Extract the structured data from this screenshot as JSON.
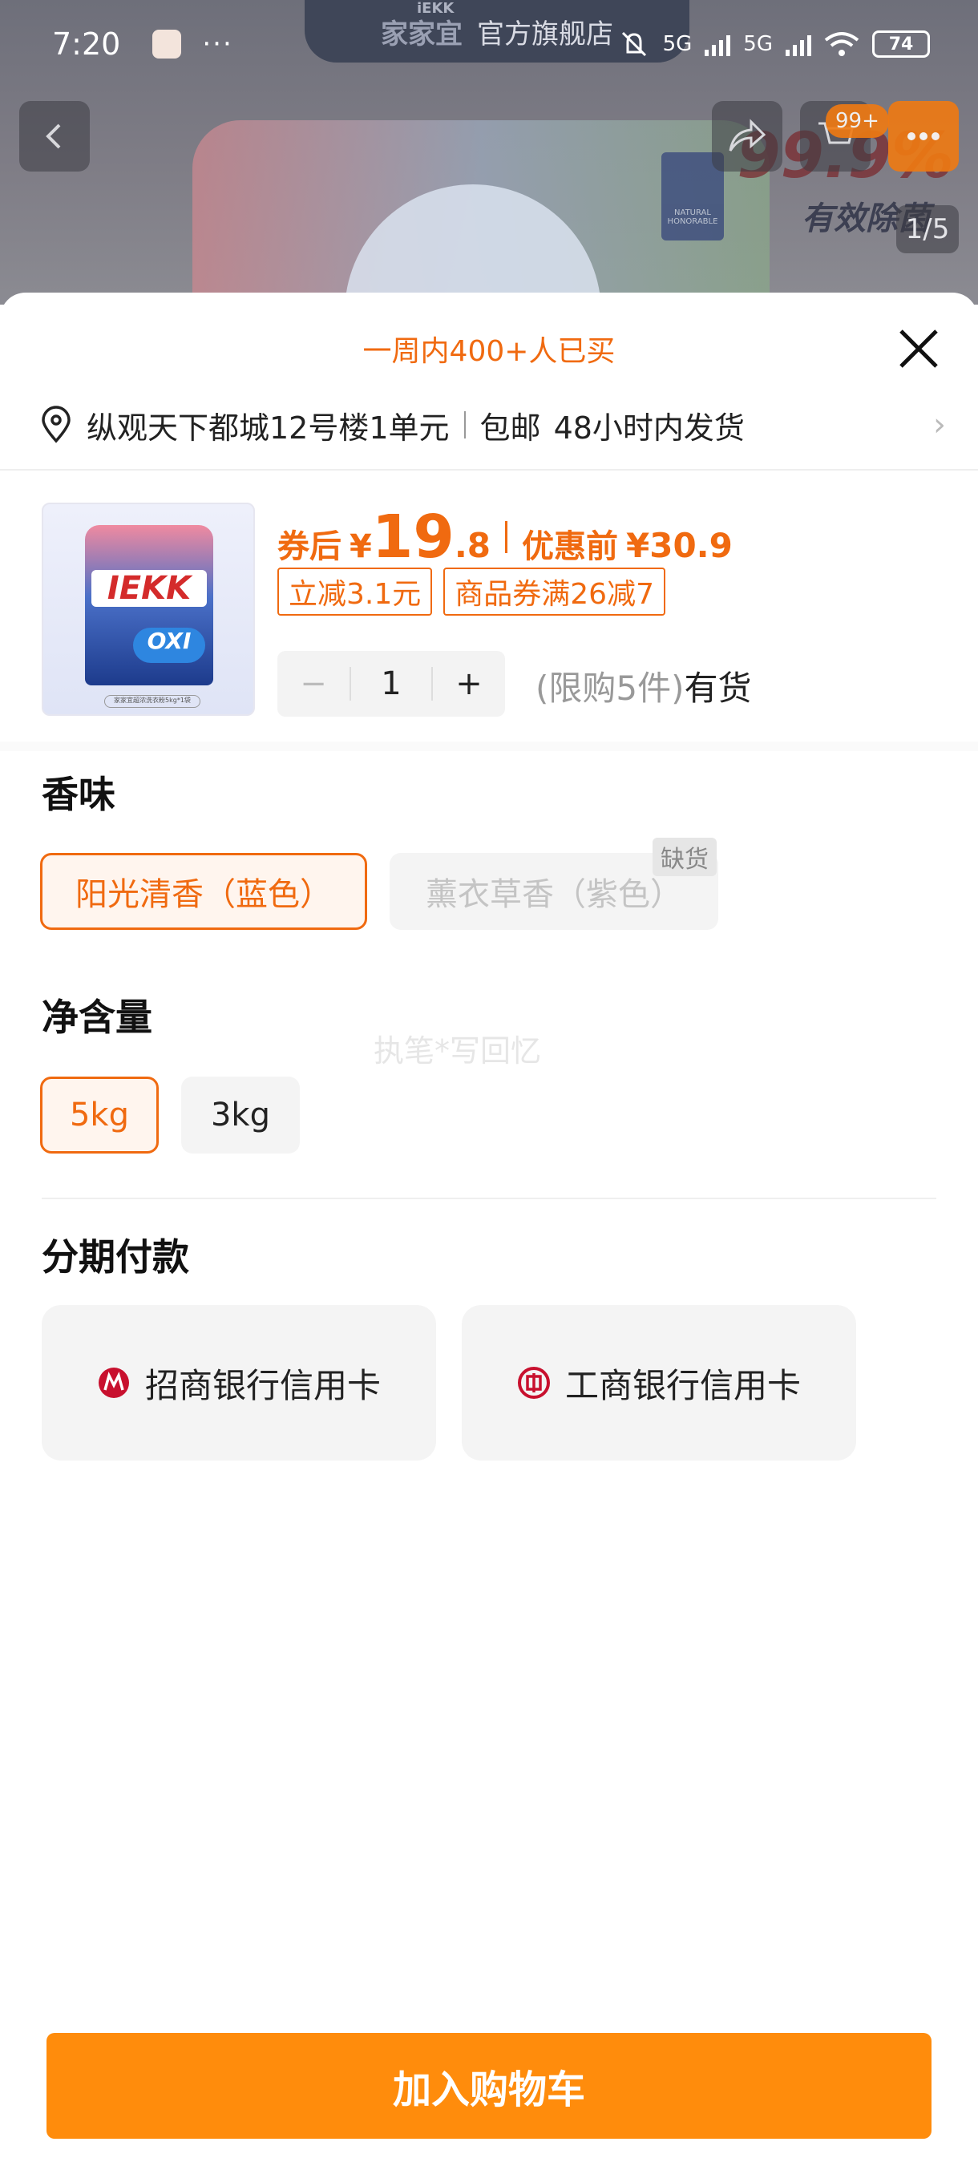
{
  "status_bar": {
    "time": "7:20",
    "dots": "···",
    "net1": "5G",
    "net2": "5G",
    "battery": "74"
  },
  "background": {
    "brand_small": "iEKK",
    "brand": "家家宜",
    "shop_name": "官方旗舰店",
    "promo": "99.9%",
    "promo_sub": "有效除菌",
    "cert": "NATURAL HONORABLE",
    "cart_count": "99+",
    "page_indicator": "1/5"
  },
  "sheet": {
    "buyers_note": "一周内400+人已买",
    "address": "纵观天下都城12号楼1单元",
    "shipping": "包邮",
    "delivery": "48小时内发货"
  },
  "product": {
    "thumb_logo": "IEKK",
    "thumb_oxi": "OXI",
    "thumb_caption": "家家宜超浓洗衣粉5kg*1袋",
    "price_label": "券后",
    "currency": "¥",
    "price_int": "19",
    "price_dec": ".8",
    "orig_label": "优惠前",
    "orig_price": "¥30.9",
    "tags": [
      "立减3.1元",
      "商品券满26减7"
    ],
    "qty_minus": "−",
    "qty": "1",
    "qty_plus": "+",
    "limit": "(限购5件)",
    "stock": "有货"
  },
  "scent": {
    "title": "香味",
    "options": [
      "阳光清香（蓝色）",
      "薰衣草香（紫色）"
    ],
    "oos_badge": "缺货"
  },
  "volume": {
    "title": "净含量",
    "options": [
      "5kg",
      "3kg"
    ]
  },
  "watermark": "执笔*写回忆",
  "installment": {
    "title": "分期付款",
    "banks": [
      "招商银行信用卡",
      "工商银行信用卡"
    ]
  },
  "cta": {
    "label": "加入购物车"
  },
  "colors": {
    "accent": "#f06a10",
    "cta": "#ff8c0c"
  }
}
